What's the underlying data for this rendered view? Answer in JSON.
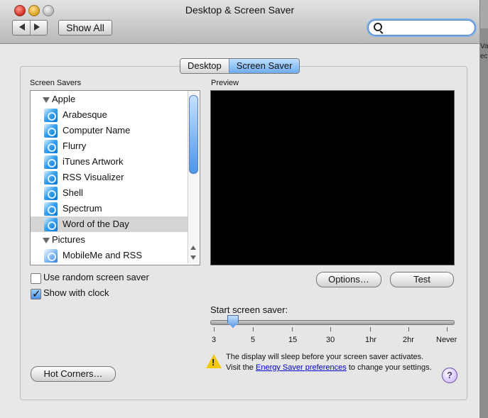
{
  "window": {
    "title": "Desktop & Screen Saver",
    "show_all_label": "Show All",
    "search_value": ""
  },
  "tabs": [
    {
      "label": "Desktop",
      "active": false
    },
    {
      "label": "Screen Saver",
      "active": true
    }
  ],
  "sections": {
    "list_label": "Screen Savers",
    "preview_label": "Preview"
  },
  "list": {
    "groups": [
      {
        "label": "Apple",
        "items": [
          "Arabesque",
          "Computer Name",
          "Flurry",
          "iTunes Artwork",
          "RSS Visualizer",
          "Shell",
          "Spectrum",
          "Word of the Day"
        ]
      },
      {
        "label": "Pictures",
        "items": [
          "MobileMe and RSS"
        ]
      }
    ],
    "selected": "Word of the Day"
  },
  "options": {
    "random_label": "Use random screen saver",
    "random_checked": false,
    "clock_label": "Show with clock",
    "clock_checked": true
  },
  "buttons": {
    "options": "Options…",
    "test": "Test",
    "hot_corners": "Hot Corners…"
  },
  "slider": {
    "label": "Start screen saver:",
    "ticks": [
      "3",
      "5",
      "15",
      "30",
      "1hr",
      "2hr",
      "Never"
    ],
    "value": "3"
  },
  "notice": {
    "line1": "The display will sleep before your screen saver activates.",
    "line2_prefix": "Visit the ",
    "link": "Energy Saver preferences",
    "line2_suffix": " to change your settings."
  },
  "side_text": [
    "Va",
    "ec"
  ],
  "colors": {
    "accent_blue": "#5c99e6",
    "link_blue": "#0000cc",
    "warning_yellow": "#f2c80c"
  }
}
